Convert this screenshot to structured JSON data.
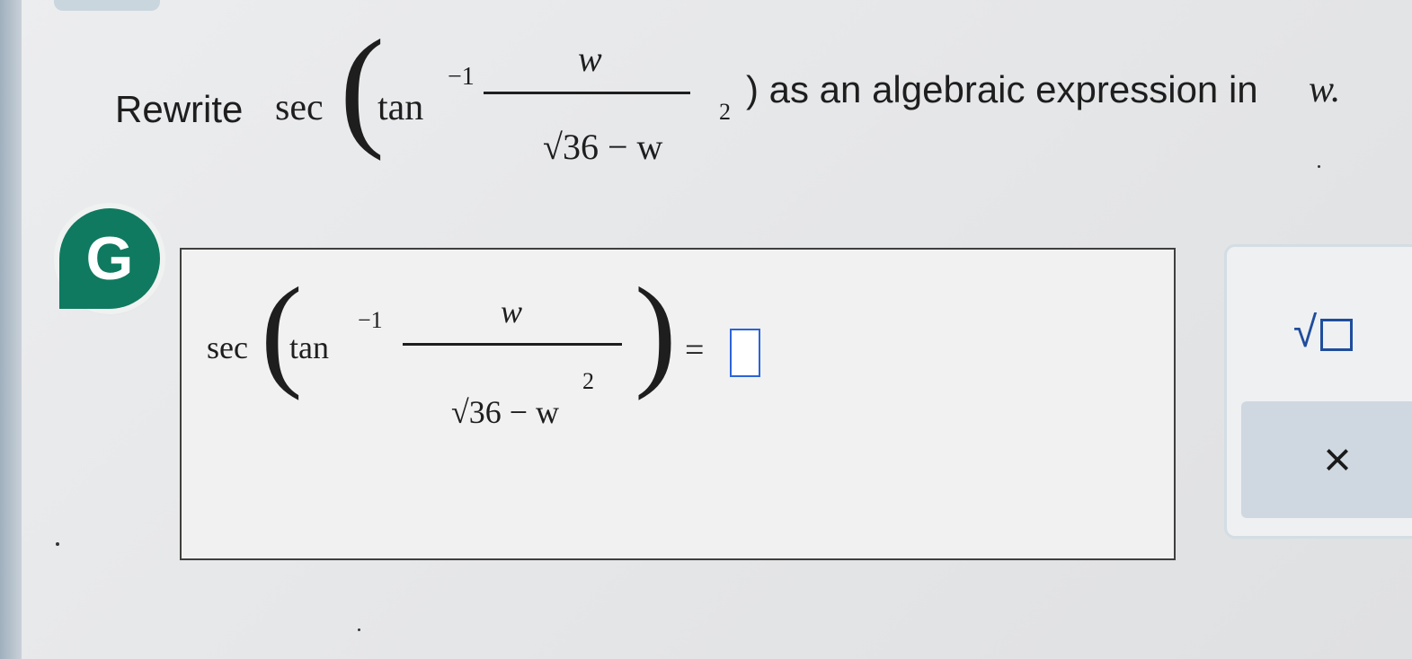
{
  "question": {
    "prefix": "Rewrite",
    "sec": "sec",
    "paren_open": "(",
    "tan": "tan",
    "inverse_exp": "−1",
    "numerator": "w",
    "radical": "√36 − w",
    "power": "2",
    "suffix": ") as an algebraic expression in",
    "variable": "w."
  },
  "answer": {
    "sec": "sec",
    "paren_open": "(",
    "tan": "tan",
    "inverse_exp": "−1",
    "numerator": "w",
    "radical": "√36 − w",
    "power": "2",
    "paren_close": ")",
    "equals": "="
  },
  "tools": {
    "sqrt_symbol": "√",
    "clear_symbol": "×"
  },
  "badge": {
    "letter": "G"
  }
}
